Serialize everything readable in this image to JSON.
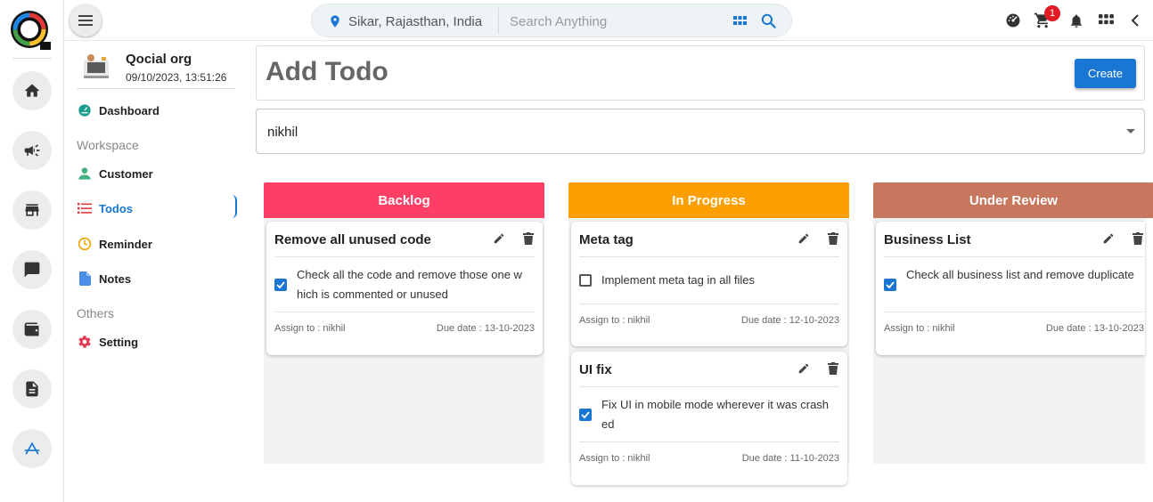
{
  "colors": {
    "accent": "#1976d2",
    "backlog": "#fd3f65",
    "in_progress": "#fd9f00",
    "under_review": "#c8775f",
    "badge": "#e01b24"
  },
  "topbar": {
    "location": "Sikar, Rajasthan, India",
    "search_placeholder": "Search Anything",
    "cart_count": "1"
  },
  "org": {
    "name": "Qocial org",
    "datetime": "09/10/2023, 13:51:26"
  },
  "nav": {
    "dashboard": "Dashboard",
    "workspace_heading": "Workspace",
    "customer": "Customer",
    "todos": "Todos",
    "reminder": "Reminder",
    "notes": "Notes",
    "others_heading": "Others",
    "setting": "Setting"
  },
  "main": {
    "title": "Add Todo",
    "create_label": "Create",
    "assignee_selected": "nikhil"
  },
  "board": {
    "backlog": {
      "title": "Backlog",
      "cards": [
        {
          "title": "Remove all unused code",
          "task": "Check all the code and remove those one which is commented or unused",
          "done": true,
          "assign": "Assign to : nikhil",
          "due": "Due date : 13-10-2023"
        }
      ]
    },
    "in_progress": {
      "title": "In Progress",
      "cards": [
        {
          "title": "Meta tag",
          "task": "Implement meta tag in all files",
          "done": false,
          "assign": "Assign to : nikhil",
          "due": "Due date : 12-10-2023"
        },
        {
          "title": "UI fix",
          "task": "Fix UI in mobile mode wherever it was crashed",
          "done": true,
          "assign": "Assign to : nikhil",
          "due": "Due date : 11-10-2023"
        }
      ]
    },
    "under_review": {
      "title": "Under Review",
      "cards": [
        {
          "title": "Business List",
          "task": "Check all business list and remove duplicate",
          "done": true,
          "assign": "Assign to : nikhil",
          "due": "Due date : 13-10-2023"
        }
      ]
    }
  }
}
